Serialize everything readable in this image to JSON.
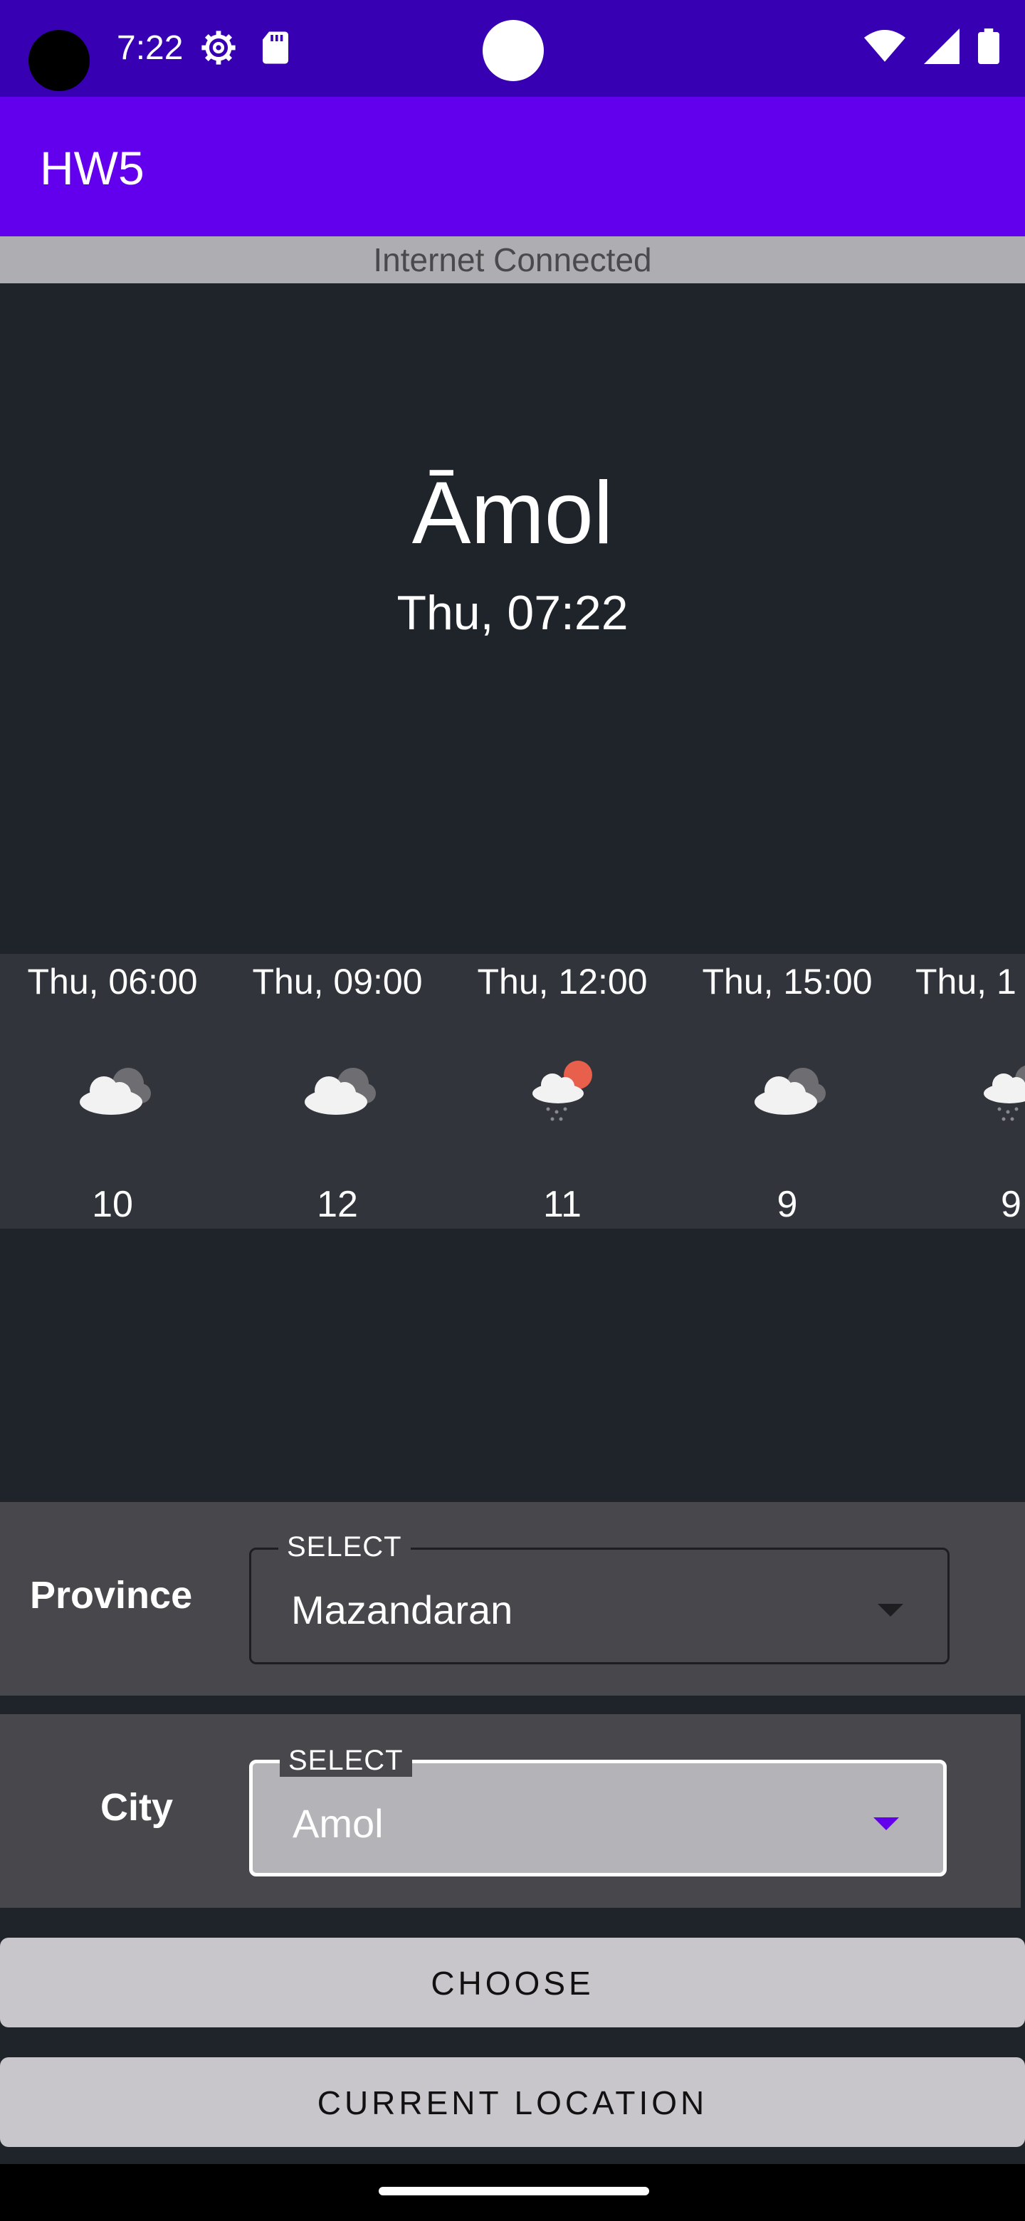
{
  "status_bar": {
    "time": "7:22",
    "icons": [
      "settings-icon",
      "sd-card-icon",
      "wifi-icon",
      "signal-icon",
      "battery-icon"
    ]
  },
  "app_bar": {
    "title": "HW5"
  },
  "network_banner": {
    "text": "Internet Connected"
  },
  "current": {
    "city": "Āmol",
    "datetime": "Thu, 07:22"
  },
  "forecast": [
    {
      "time": "Thu,  06:00",
      "icon": "cloudy-icon",
      "temp": "10"
    },
    {
      "time": "Thu,  09:00",
      "icon": "cloudy-icon",
      "temp": "12"
    },
    {
      "time": "Thu,  12:00",
      "icon": "rain-sun-icon",
      "temp": "11"
    },
    {
      "time": "Thu,  15:00",
      "icon": "cloudy-icon",
      "temp": "9"
    },
    {
      "time": "Thu,  1",
      "icon": "rain-icon",
      "temp": "9"
    }
  ],
  "province": {
    "label": "Province",
    "legend": "SELECT",
    "value": "Mazandaran"
  },
  "city": {
    "label": "City",
    "legend": "SELECT",
    "value": "Amol"
  },
  "buttons": {
    "choose": "CHOOSE",
    "current_location": "CURRENT LOCATION"
  },
  "colors": {
    "status_bar": "#3700b3",
    "app_bar": "#6200ee",
    "background": "#1f242b",
    "accent": "#6200ee"
  }
}
